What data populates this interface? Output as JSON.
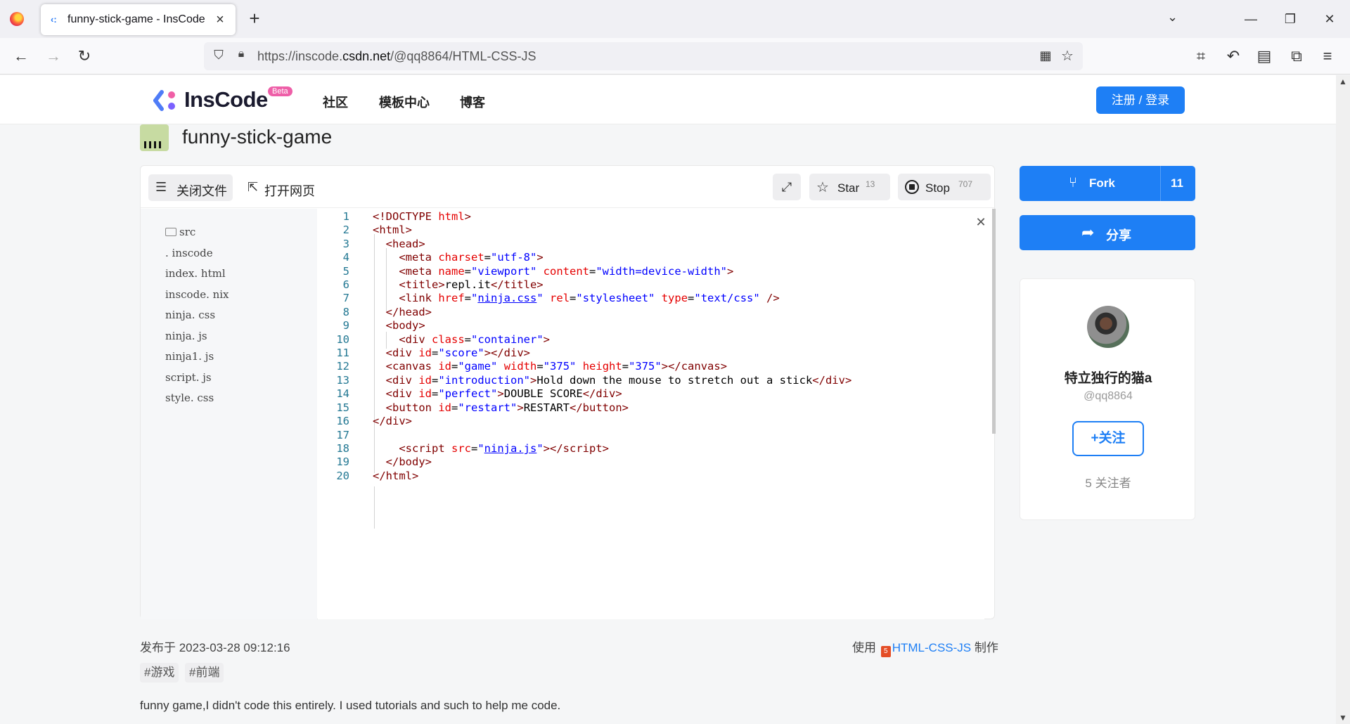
{
  "browser": {
    "tab_title": "funny-stick-game - InsCode",
    "url_prefix": "https://inscode.",
    "url_domain": "csdn.net",
    "url_path": "/@qq8864/HTML-CSS-JS"
  },
  "site": {
    "logo_text": "InsCode",
    "beta": "Beta",
    "menu": [
      "社区",
      "模板中心",
      "博客"
    ],
    "login": "注册 / 登录"
  },
  "project": {
    "title": "funny-stick-game"
  },
  "toolbar": {
    "close_files": "关闭文件",
    "open_web": "打开网页",
    "star_label": "Star",
    "star_count": "13",
    "stop_label": "Stop",
    "stop_count": "707"
  },
  "files": [
    "src",
    ". inscode",
    "index. html",
    "inscode. nix",
    "ninja. css",
    "ninja. js",
    "ninja1. js",
    "script. js",
    "style. css"
  ],
  "code_lines": [
    "1",
    "2",
    "3",
    "4",
    "5",
    "6",
    "7",
    "8",
    "9",
    "10",
    "11",
    "12",
    "13",
    "14",
    "15",
    "16",
    "17",
    "18",
    "19",
    "20"
  ],
  "meta": {
    "published": "发布于 2023-03-28 09:12:16",
    "made_with_prefix": "使用",
    "template_link": "HTML-CSS-JS",
    "made_with_suffix": "制作",
    "tags": [
      "#游戏",
      "#前端"
    ],
    "description": "funny game,I didn't code this entirely. I used tutorials and such to help me code."
  },
  "side": {
    "fork_label": "Fork",
    "fork_count": "11",
    "share_label": "分享",
    "user_name": "特立独行的猫a",
    "user_handle": "@qq8864",
    "follow": "关注",
    "followers": "5 关注者"
  },
  "colors": {
    "accent": "#1e7ff5",
    "beta_badge": "#ee5fa8",
    "code_tag": "#800000",
    "code_attr": "#e50000",
    "code_value": "#0000ff"
  }
}
